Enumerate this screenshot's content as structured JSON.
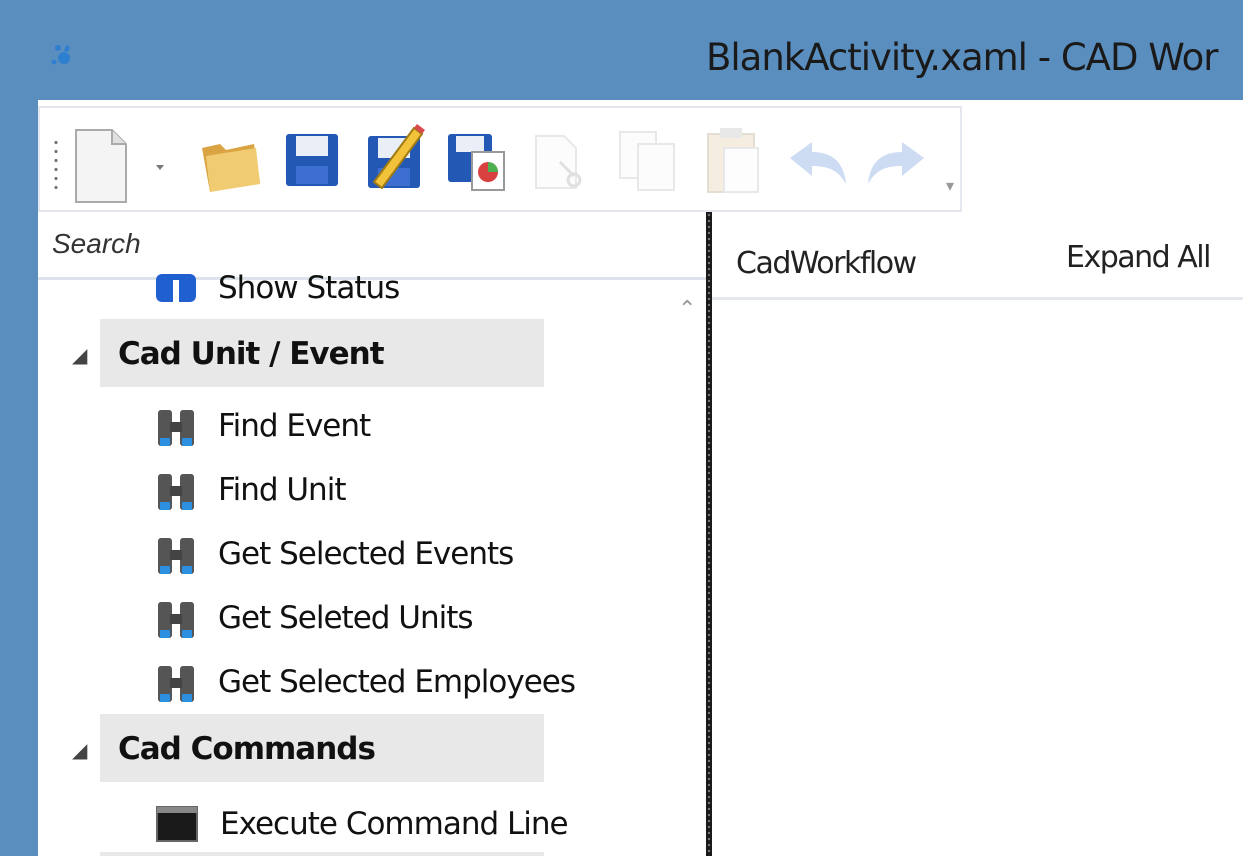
{
  "window": {
    "title": "BlankActivity.xaml - CAD Wor",
    "app_icon": "gear-workflow-icon"
  },
  "toolbar": {
    "buttons": [
      {
        "name": "new-document-button",
        "icon": "new-document-icon",
        "enabled": true
      },
      {
        "name": "new-dropdown-button",
        "icon": "dropdown-arrow-icon",
        "enabled": true
      },
      {
        "name": "open-folder-button",
        "icon": "folder-icon",
        "enabled": true
      },
      {
        "name": "save-button",
        "icon": "floppy-disk-icon",
        "enabled": true
      },
      {
        "name": "save-as-button",
        "icon": "floppy-pencil-icon",
        "enabled": true
      },
      {
        "name": "save-all-button",
        "icon": "floppy-chart-icon",
        "enabled": true
      },
      {
        "name": "cut-button",
        "icon": "scissors-icon",
        "enabled": false
      },
      {
        "name": "copy-button",
        "icon": "copy-icon",
        "enabled": false
      },
      {
        "name": "paste-button",
        "icon": "clipboard-icon",
        "enabled": false
      },
      {
        "name": "undo-button",
        "icon": "undo-arrow-icon",
        "enabled": false
      },
      {
        "name": "redo-button",
        "icon": "redo-arrow-icon",
        "enabled": false
      }
    ]
  },
  "toolbox": {
    "search_placeholder": "Search",
    "items": [
      {
        "type": "item",
        "label": "Show Status",
        "icon": "status-icon"
      },
      {
        "type": "category",
        "label": "Cad Unit / Event",
        "expanded": true
      },
      {
        "type": "item",
        "label": "Find Event",
        "icon": "binoculars-icon"
      },
      {
        "type": "item",
        "label": "Find Unit",
        "icon": "binoculars-icon"
      },
      {
        "type": "item",
        "label": "Get Selected Events",
        "icon": "binoculars-icon"
      },
      {
        "type": "item",
        "label": "Get Seleted Units",
        "icon": "binoculars-icon"
      },
      {
        "type": "item",
        "label": "Get Selected Employees",
        "icon": "binoculars-icon"
      },
      {
        "type": "category",
        "label": "Cad Commands",
        "expanded": true
      },
      {
        "type": "item",
        "label": "Execute Command Line",
        "icon": "command-line-icon"
      }
    ]
  },
  "designer": {
    "breadcrumb": "CadWorkflow",
    "expand_all": "Expand All"
  }
}
